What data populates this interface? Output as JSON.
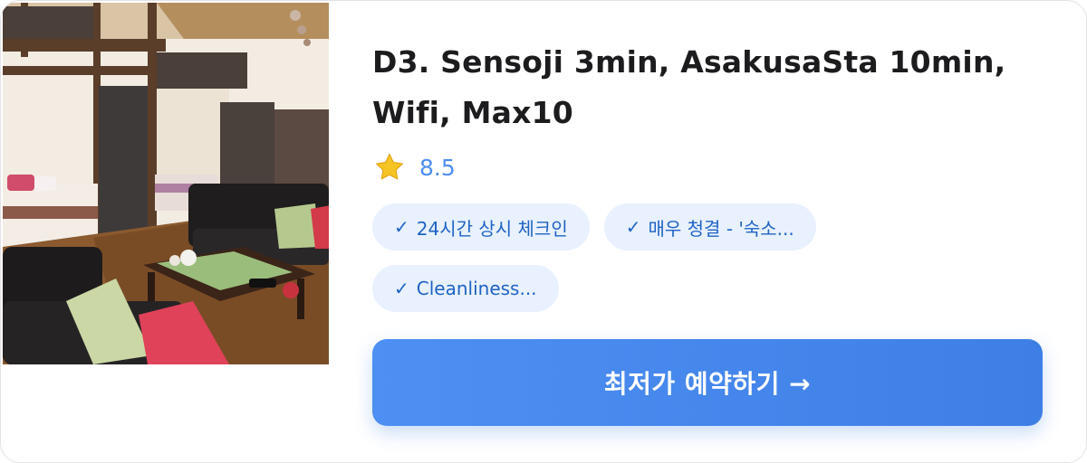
{
  "listing": {
    "title": "D3. Sensoji 3min, AsakusaSta 10min, Wifi, Max10",
    "rating": "8.5",
    "tags": [
      {
        "check": "✓",
        "label": "24시간 상시 체크인"
      },
      {
        "check": "✓",
        "label": "매우 청결 - '숙소..."
      },
      {
        "check": "✓",
        "label": "Cleanliness..."
      }
    ],
    "cta_label": "최저가 예약하기 →"
  },
  "icons": {
    "rating_icon": "star-icon",
    "photo": "room-photo"
  },
  "colors": {
    "accent": "#4f8ef0",
    "tag_bg": "#e8f1fd",
    "tag_text": "#1f63c4",
    "button": "#4589ee",
    "star": "#f6c325"
  }
}
